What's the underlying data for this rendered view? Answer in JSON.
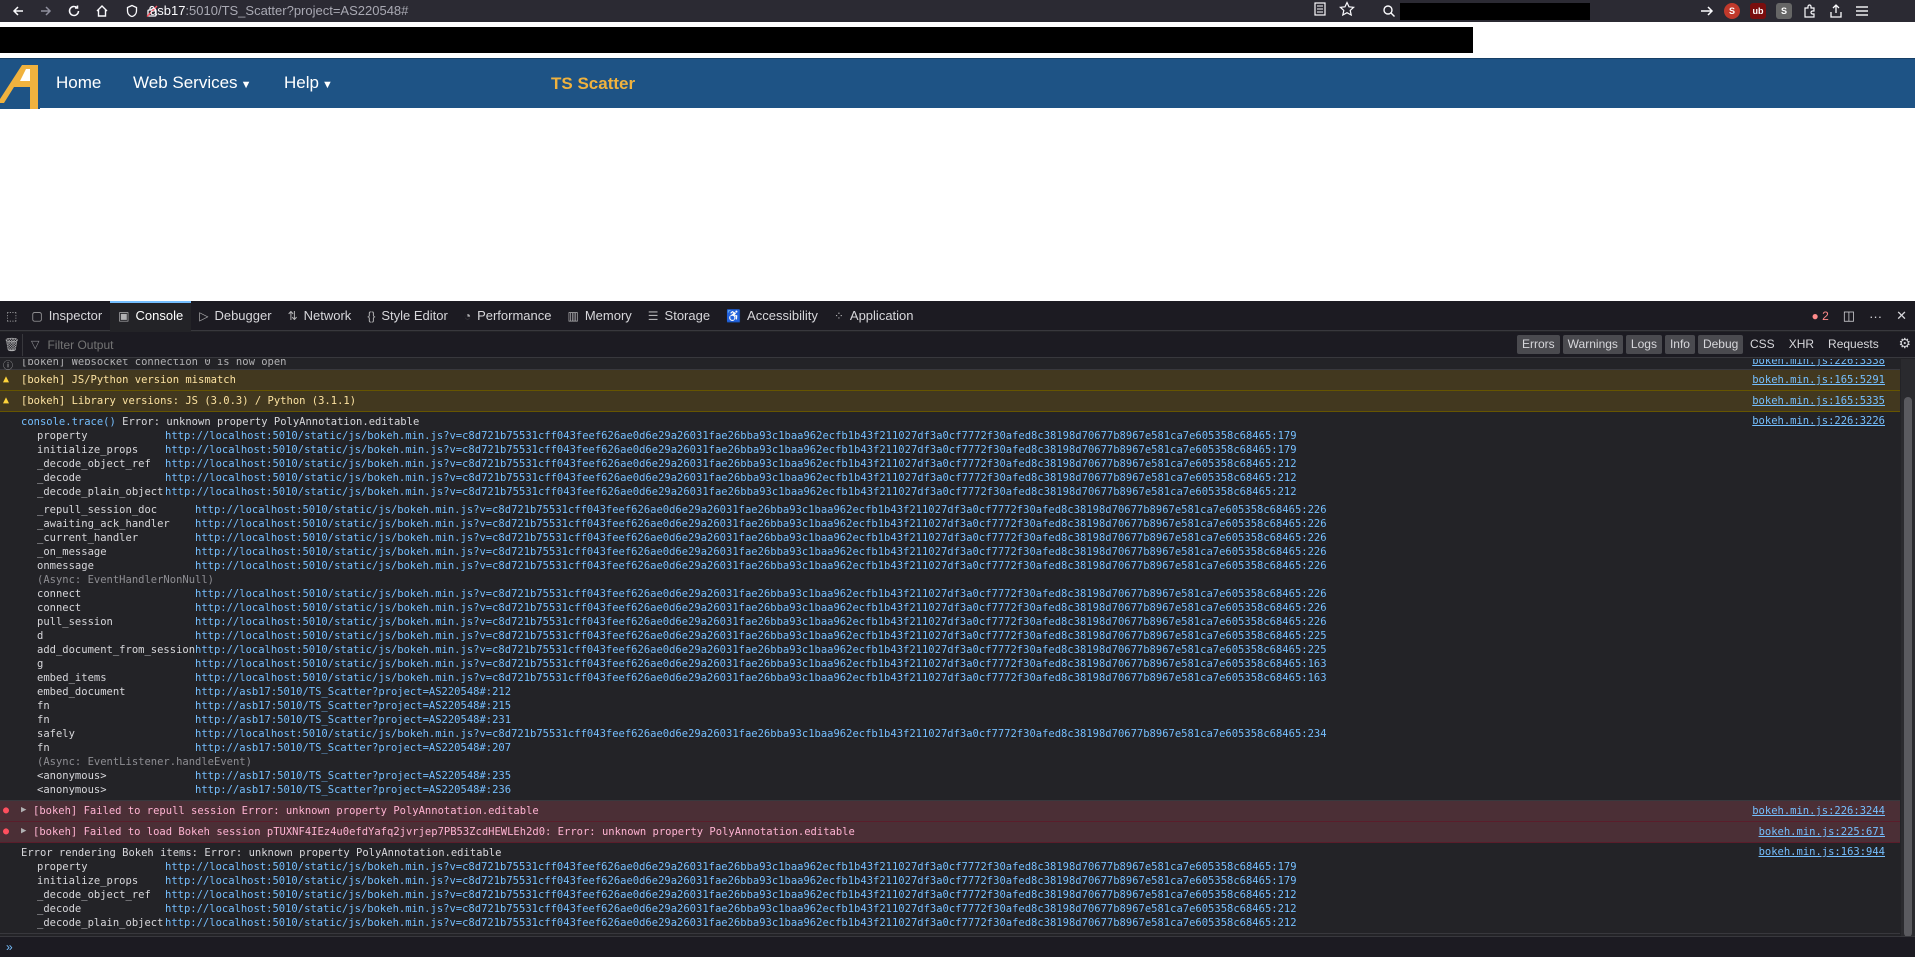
{
  "browser": {
    "url_host": "asb17",
    "url_rest": ":5010/TS_Scatter?project=AS220548#"
  },
  "app": {
    "nav": [
      "Home",
      "Web Services",
      "Help"
    ],
    "title": "TS Scatter",
    "accent": "#f0b23e",
    "nav_bg": "#1e5385"
  },
  "devtools": {
    "tabs": [
      "Inspector",
      "Console",
      "Debugger",
      "Network",
      "Style Editor",
      "Performance",
      "Memory",
      "Storage",
      "Accessibility",
      "Application"
    ],
    "error_count": "2",
    "filter_placeholder": "Filter Output",
    "filter_buttons": [
      "Errors",
      "Warnings",
      "Logs",
      "Info",
      "Debug"
    ],
    "filter_plain": [
      "CSS",
      "XHR",
      "Requests"
    ],
    "messages": {
      "info1": {
        "text": "[bokeh] Websocket connection 0 is now open",
        "src": "bokeh.min.js:226:3338"
      },
      "warn1": {
        "text": "[bokeh] JS/Python version mismatch",
        "src": "bokeh.min.js:165:5291"
      },
      "warn2": {
        "text": "[bokeh] Library versions: JS (3.0.3) / Python (3.1.1)",
        "src": "bokeh.min.js:165:5335"
      },
      "trace1": {
        "head_kw": "console.trace()",
        "head_text": " Error: unknown property PolyAnnotation.editable",
        "src": "bokeh.min.js:226:3226"
      },
      "err1": {
        "text": "[bokeh] Failed to repull session Error: unknown property PolyAnnotation.editable",
        "src": "bokeh.min.js:226:3244"
      },
      "err2": {
        "text": "[bokeh] Failed to load Bokeh session pTUXNF4IEz4u0efdYafq2jvrjep7PB53ZcdHEWLEh2d0: Error: unknown property PolyAnnotation.editable",
        "src": "bokeh.min.js:225:671"
      },
      "trace2": {
        "head_text": "Error rendering Bokeh items: Error: unknown property PolyAnnotation.editable",
        "src": "bokeh.min.js:163:944"
      }
    },
    "frames1a": [
      [
        "property",
        "http://localhost:5010/static/js/bokeh.min.js?v=c8d721b75531cff043feef626ae0d6e29a26031fae26bba93c1baa962ecfb1b43f211027df3a0cf7772f30afed8c38198d70677b8967e581ca7e605358c68465:179"
      ],
      [
        "initialize_props",
        "http://localhost:5010/static/js/bokeh.min.js?v=c8d721b75531cff043feef626ae0d6e29a26031fae26bba93c1baa962ecfb1b43f211027df3a0cf7772f30afed8c38198d70677b8967e581ca7e605358c68465:179"
      ],
      [
        "_decode_object_ref",
        "http://localhost:5010/static/js/bokeh.min.js?v=c8d721b75531cff043feef626ae0d6e29a26031fae26bba93c1baa962ecfb1b43f211027df3a0cf7772f30afed8c38198d70677b8967e581ca7e605358c68465:212"
      ],
      [
        "_decode",
        "http://localhost:5010/static/js/bokeh.min.js?v=c8d721b75531cff043feef626ae0d6e29a26031fae26bba93c1baa962ecfb1b43f211027df3a0cf7772f30afed8c38198d70677b8967e581ca7e605358c68465:212"
      ],
      [
        "_decode_plain_object",
        "http://localhost:5010/static/js/bokeh.min.js?v=c8d721b75531cff043feef626ae0d6e29a26031fae26bba93c1baa962ecfb1b43f211027df3a0cf7772f30afed8c38198d70677b8967e581ca7e605358c68465:212"
      ]
    ],
    "frames1b": [
      [
        "_repull_session_doc",
        "http://localhost:5010/static/js/bokeh.min.js?v=c8d721b75531cff043feef626ae0d6e29a26031fae26bba93c1baa962ecfb1b43f211027df3a0cf7772f30afed8c38198d70677b8967e581ca7e605358c68465:226"
      ],
      [
        "_awaiting_ack_handler",
        "http://localhost:5010/static/js/bokeh.min.js?v=c8d721b75531cff043feef626ae0d6e29a26031fae26bba93c1baa962ecfb1b43f211027df3a0cf7772f30afed8c38198d70677b8967e581ca7e605358c68465:226"
      ],
      [
        "_current_handler",
        "http://localhost:5010/static/js/bokeh.min.js?v=c8d721b75531cff043feef626ae0d6e29a26031fae26bba93c1baa962ecfb1b43f211027df3a0cf7772f30afed8c38198d70677b8967e581ca7e605358c68465:226"
      ],
      [
        "_on_message",
        "http://localhost:5010/static/js/bokeh.min.js?v=c8d721b75531cff043feef626ae0d6e29a26031fae26bba93c1baa962ecfb1b43f211027df3a0cf7772f30afed8c38198d70677b8967e581ca7e605358c68465:226"
      ],
      [
        "onmessage",
        "http://localhost:5010/static/js/bokeh.min.js?v=c8d721b75531cff043feef626ae0d6e29a26031fae26bba93c1baa962ecfb1b43f211027df3a0cf7772f30afed8c38198d70677b8967e581ca7e605358c68465:226"
      ],
      [
        "(Async: EventHandlerNonNull)",
        ""
      ],
      [
        "connect",
        "http://localhost:5010/static/js/bokeh.min.js?v=c8d721b75531cff043feef626ae0d6e29a26031fae26bba93c1baa962ecfb1b43f211027df3a0cf7772f30afed8c38198d70677b8967e581ca7e605358c68465:226"
      ],
      [
        "connect",
        "http://localhost:5010/static/js/bokeh.min.js?v=c8d721b75531cff043feef626ae0d6e29a26031fae26bba93c1baa962ecfb1b43f211027df3a0cf7772f30afed8c38198d70677b8967e581ca7e605358c68465:226"
      ],
      [
        "pull_session",
        "http://localhost:5010/static/js/bokeh.min.js?v=c8d721b75531cff043feef626ae0d6e29a26031fae26bba93c1baa962ecfb1b43f211027df3a0cf7772f30afed8c38198d70677b8967e581ca7e605358c68465:226"
      ],
      [
        "d",
        "http://localhost:5010/static/js/bokeh.min.js?v=c8d721b75531cff043feef626ae0d6e29a26031fae26bba93c1baa962ecfb1b43f211027df3a0cf7772f30afed8c38198d70677b8967e581ca7e605358c68465:225"
      ],
      [
        "add_document_from_session",
        "http://localhost:5010/static/js/bokeh.min.js?v=c8d721b75531cff043feef626ae0d6e29a26031fae26bba93c1baa962ecfb1b43f211027df3a0cf7772f30afed8c38198d70677b8967e581ca7e605358c68465:225"
      ],
      [
        "g",
        "http://localhost:5010/static/js/bokeh.min.js?v=c8d721b75531cff043feef626ae0d6e29a26031fae26bba93c1baa962ecfb1b43f211027df3a0cf7772f30afed8c38198d70677b8967e581ca7e605358c68465:163"
      ],
      [
        "embed_items",
        "http://localhost:5010/static/js/bokeh.min.js?v=c8d721b75531cff043feef626ae0d6e29a26031fae26bba93c1baa962ecfb1b43f211027df3a0cf7772f30afed8c38198d70677b8967e581ca7e605358c68465:163"
      ],
      [
        "embed_document",
        "http://asb17:5010/TS_Scatter?project=AS220548#:212"
      ],
      [
        "fn",
        "http://asb17:5010/TS_Scatter?project=AS220548#:215"
      ],
      [
        "fn",
        "http://asb17:5010/TS_Scatter?project=AS220548#:231"
      ],
      [
        "safely",
        "http://localhost:5010/static/js/bokeh.min.js?v=c8d721b75531cff043feef626ae0d6e29a26031fae26bba93c1baa962ecfb1b43f211027df3a0cf7772f30afed8c38198d70677b8967e581ca7e605358c68465:234"
      ],
      [
        "fn",
        "http://asb17:5010/TS_Scatter?project=AS220548#:207"
      ],
      [
        "(Async: EventListener.handleEvent)",
        ""
      ],
      [
        "<anonymous>",
        "http://asb17:5010/TS_Scatter?project=AS220548#:235"
      ],
      [
        "<anonymous>",
        "http://asb17:5010/TS_Scatter?project=AS220548#:236"
      ]
    ],
    "frames2": [
      [
        "property",
        "http://localhost:5010/static/js/bokeh.min.js?v=c8d721b75531cff043feef626ae0d6e29a26031fae26bba93c1baa962ecfb1b43f211027df3a0cf7772f30afed8c38198d70677b8967e581ca7e605358c68465:179"
      ],
      [
        "initialize_props",
        "http://localhost:5010/static/js/bokeh.min.js?v=c8d721b75531cff043feef626ae0d6e29a26031fae26bba93c1baa962ecfb1b43f211027df3a0cf7772f30afed8c38198d70677b8967e581ca7e605358c68465:179"
      ],
      [
        "_decode_object_ref",
        "http://localhost:5010/static/js/bokeh.min.js?v=c8d721b75531cff043feef626ae0d6e29a26031fae26bba93c1baa962ecfb1b43f211027df3a0cf7772f30afed8c38198d70677b8967e581ca7e605358c68465:212"
      ],
      [
        "_decode",
        "http://localhost:5010/static/js/bokeh.min.js?v=c8d721b75531cff043feef626ae0d6e29a26031fae26bba93c1baa962ecfb1b43f211027df3a0cf7772f30afed8c38198d70677b8967e581ca7e605358c68465:212"
      ],
      [
        "_decode_plain_object",
        "http://localhost:5010/static/js/bokeh.min.js?v=c8d721b75531cff043feef626ae0d6e29a26031fae26bba93c1baa962ecfb1b43f211027df3a0cf7772f30afed8c38198d70677b8967e581ca7e605358c68465:212"
      ]
    ],
    "console_prompt": "»"
  }
}
